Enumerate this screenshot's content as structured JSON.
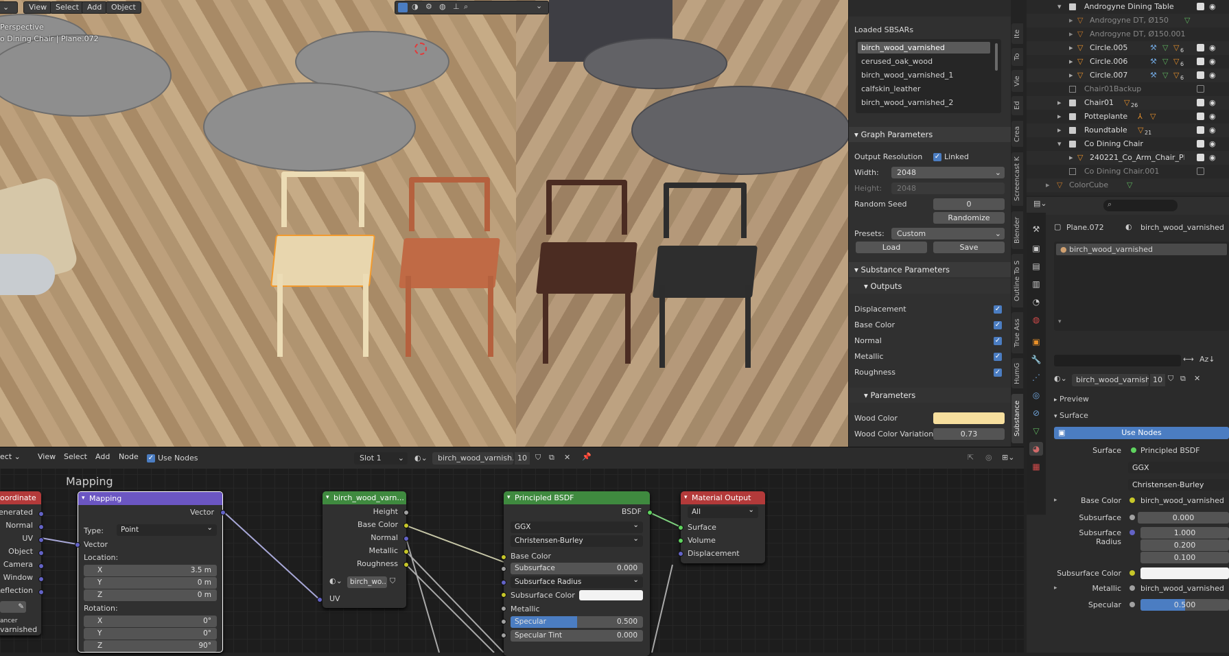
{
  "viewport": {
    "menu": [
      "View",
      "Select",
      "Add",
      "Object"
    ],
    "overlay_line1": "Perspective",
    "overlay_line2": "o Dining Chair | Plane.072",
    "colors": {
      "chair1": "#ecdcb5",
      "chair2": "#b5613e",
      "chair3": "#4b2c22",
      "chair4": "#2d2d2d"
    }
  },
  "npanel": {
    "loaded_title": "Loaded SBSARs",
    "sbsars": [
      "birch_wood_varnished",
      "cerused_oak_wood",
      "birch_wood_varnished_1",
      "calfskin_leather",
      "birch_wood_varnished_2"
    ],
    "graph_params": "Graph Parameters",
    "output_res": "Output Resolution",
    "linked": "Linked",
    "width_label": "Width:",
    "width_value": "2048",
    "height_label": "Height:",
    "height_value": "2048",
    "seed_label": "Random Seed",
    "seed_value": "0",
    "randomize": "Randomize",
    "presets_label": "Presets:",
    "presets_value": "Custom",
    "load": "Load",
    "save": "Save",
    "substance_params": "Substance Parameters",
    "outputs": "Outputs",
    "output_list": [
      "Displacement",
      "Base Color",
      "Normal",
      "Metallic",
      "Roughness"
    ],
    "parameters": "Parameters",
    "wood_color": "Wood Color",
    "wood_color_hex": "#f7df9e",
    "wood_var": "Wood Color Variation",
    "wood_var_value": "0.73"
  },
  "vtabs": [
    "Ite",
    "To",
    "Vie",
    "Ed",
    "Crea",
    "Screencast K",
    "Blender",
    "Outline To S",
    "True Ass",
    "HumG",
    "Substance"
  ],
  "outliner": {
    "rows": [
      "Androgyne Dining Table",
      "Androgyne DT, Ø150",
      "Androgyne DT, Ø150.001",
      "Circle.005",
      "Circle.006",
      "Circle.007",
      "Chair01Backup",
      "Chair01",
      "Potteplante",
      "Roundtable",
      "Co Dining Chair",
      "240221_Co_Arm_Chair_Pl",
      "Co Dining Chair.001",
      "ColorCube"
    ],
    "badges": {
      "chair01": "26",
      "roundtable": "21",
      "c5": "6",
      "c6": "6",
      "c7": "6"
    }
  },
  "props": {
    "object": "Plane.072",
    "material": "birch_wood_varnished",
    "slot": "birch_wood_varnished",
    "mat_name": "birch_wood_varnished",
    "users": "10",
    "preview": "Preview",
    "surface": "Surface",
    "use_nodes": "Use Nodes",
    "surface_label": "Surface",
    "surface_value": "Principled BSDF",
    "dist": "GGX",
    "sss_method": "Christensen-Burley",
    "base_color": "Base Color",
    "base_color_value": "birch_wood_varnished",
    "subsurface": "Subsurface",
    "subsurface_value": "0.000",
    "sss_radius": "Subsurface Radius",
    "radius": [
      "1.000",
      "0.200",
      "0.100"
    ],
    "sss_color": "Subsurface Color",
    "metallic": "Metallic",
    "metallic_value": "birch_wood_varnished",
    "specular": "Specular",
    "specular_value": "0.500"
  },
  "node_editor": {
    "menu": [
      "ect",
      "View",
      "Select",
      "Add",
      "Node"
    ],
    "use_nodes": "Use Nodes",
    "slot": "Slot 1",
    "mat": "birch_wood_varnish...",
    "users": "10",
    "frame_label": "Mapping",
    "texcoord": {
      "title": "oordinate",
      "outputs": [
        "Generated",
        "Normal",
        "UV",
        "Object",
        "Camera",
        "Window",
        "Reflection"
      ],
      "footer": "ancer",
      "footer2": "varnished"
    },
    "mapping": {
      "title": "Mapping",
      "out": "Vector",
      "type_label": "Type:",
      "type": "Point",
      "in": "Vector",
      "location": "Location:",
      "loc": [
        "3.5 m",
        "0 m",
        "0 m"
      ],
      "rotation": "Rotation:",
      "rot": [
        "0°",
        "0°",
        "90°"
      ],
      "axes": [
        "X",
        "Y",
        "Z"
      ]
    },
    "sbsar": {
      "title": "birch_wood_varn...",
      "outputs": [
        "Height",
        "Base Color",
        "Normal",
        "Metallic",
        "Roughness"
      ],
      "img": "birch_wo...",
      "in": "UV"
    },
    "bsdf": {
      "title": "Principled BSDF",
      "out": "BSDF",
      "dist": "GGX",
      "sss": "Christensen-Burley",
      "base_color": "Base Color",
      "subsurface": "Subsurface",
      "subsurface_value": "0.000",
      "sss_radius": "Subsurface Radius",
      "sss_color": "Subsurface Color",
      "metallic": "Metallic",
      "specular": "Specular",
      "specular_value": "0.500",
      "specular_num": 0.5,
      "spec_tint": "Specular Tint",
      "spec_tint_value": "0.000"
    },
    "output": {
      "title": "Material Output",
      "target": "All",
      "inputs": [
        "Surface",
        "Volume",
        "Displacement"
      ]
    }
  }
}
